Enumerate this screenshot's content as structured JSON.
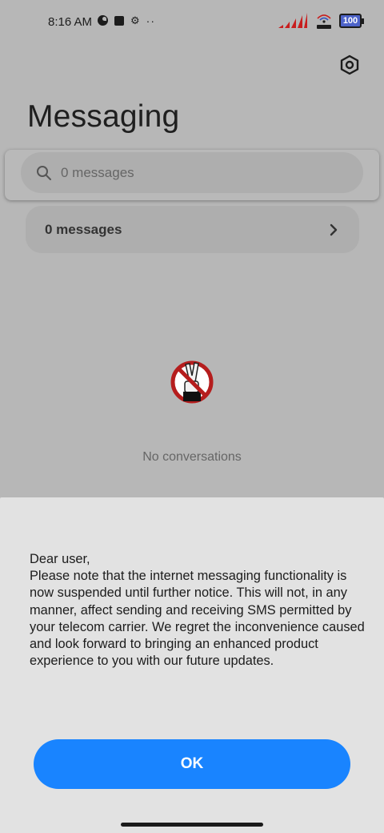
{
  "status_bar": {
    "time": "8:16 AM",
    "battery": "100",
    "icons_left": [
      "app-circle-icon",
      "square-icon",
      "gear-icon",
      "more-dots-icon"
    ],
    "icons_right": [
      "signal-icon",
      "wifi-icon",
      "battery-icon"
    ]
  },
  "header": {
    "title": "Messaging",
    "settings_icon": "settings-hexagon-icon"
  },
  "search": {
    "placeholder": "0 messages"
  },
  "messages_row": {
    "label": "0 messages"
  },
  "empty_state": {
    "text": "No conversations",
    "illustration": "prohibited-hand-icon"
  },
  "dialog": {
    "message": "Dear user,\nPlease note that the internet messaging functionality is now suspended until further notice. This will not, in any manner, affect sending and receiving SMS permitted by your telecom carrier. We regret the inconvenience caused and look forward to bringing an enhanced product experience to you with our future updates.",
    "ok_label": "OK"
  },
  "colors": {
    "accent": "#1984ff",
    "dimmed_background": "#b7b7b7",
    "dialog_background": "#e2e2e2"
  }
}
